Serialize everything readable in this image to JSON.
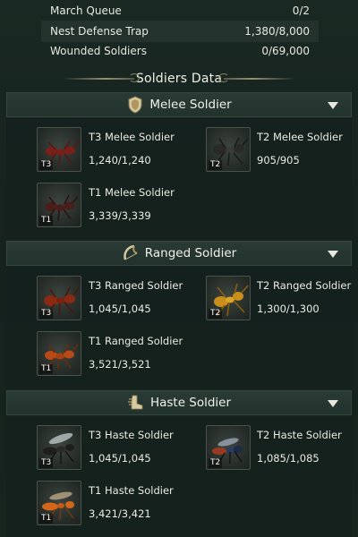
{
  "stats": [
    {
      "label": "March Queue",
      "value": "0/2"
    },
    {
      "label": "Nest Defense Trap",
      "value": "1,380/8,000"
    },
    {
      "label": "Wounded Soldiers",
      "value": "0/69,000"
    }
  ],
  "title": "Soldiers Data",
  "sections": [
    {
      "title": "Melee Soldier",
      "icon": "shield-icon",
      "units": [
        {
          "name": "T3 Melee Soldier",
          "count": "1,240/1,240",
          "tier": "T3",
          "color": "#7a1f1a"
        },
        {
          "name": "T2 Melee Soldier",
          "count": "905/905",
          "tier": "T2",
          "color": "#2a2a28"
        },
        {
          "name": "T1 Melee Soldier",
          "count": "3,339/3,339",
          "tier": "T1",
          "color": "#4a1e1a"
        }
      ]
    },
    {
      "title": "Ranged Soldier",
      "icon": "bow-icon",
      "units": [
        {
          "name": "T3 Ranged Soldier",
          "count": "1,045/1,045",
          "tier": "T3",
          "color": "#8a2a14"
        },
        {
          "name": "T2 Ranged Soldier",
          "count": "1,300/1,300",
          "tier": "T2",
          "color": "#c8901a"
        },
        {
          "name": "T1 Ranged Soldier",
          "count": "3,521/3,521",
          "tier": "T1",
          "color": "#b84a18"
        }
      ]
    },
    {
      "title": "Haste Soldier",
      "icon": "boot-icon",
      "units": [
        {
          "name": "T3 Haste Soldier",
          "count": "1,045/1,045",
          "tier": "T3",
          "color": "#1e1e1e"
        },
        {
          "name": "T2 Haste Soldier",
          "count": "1,085/1,085",
          "tier": "T2",
          "color": "#9a3a20"
        },
        {
          "name": "T1 Haste Soldier",
          "count": "3,421/3,421",
          "tier": "T1",
          "color": "#d4661a"
        }
      ]
    }
  ]
}
